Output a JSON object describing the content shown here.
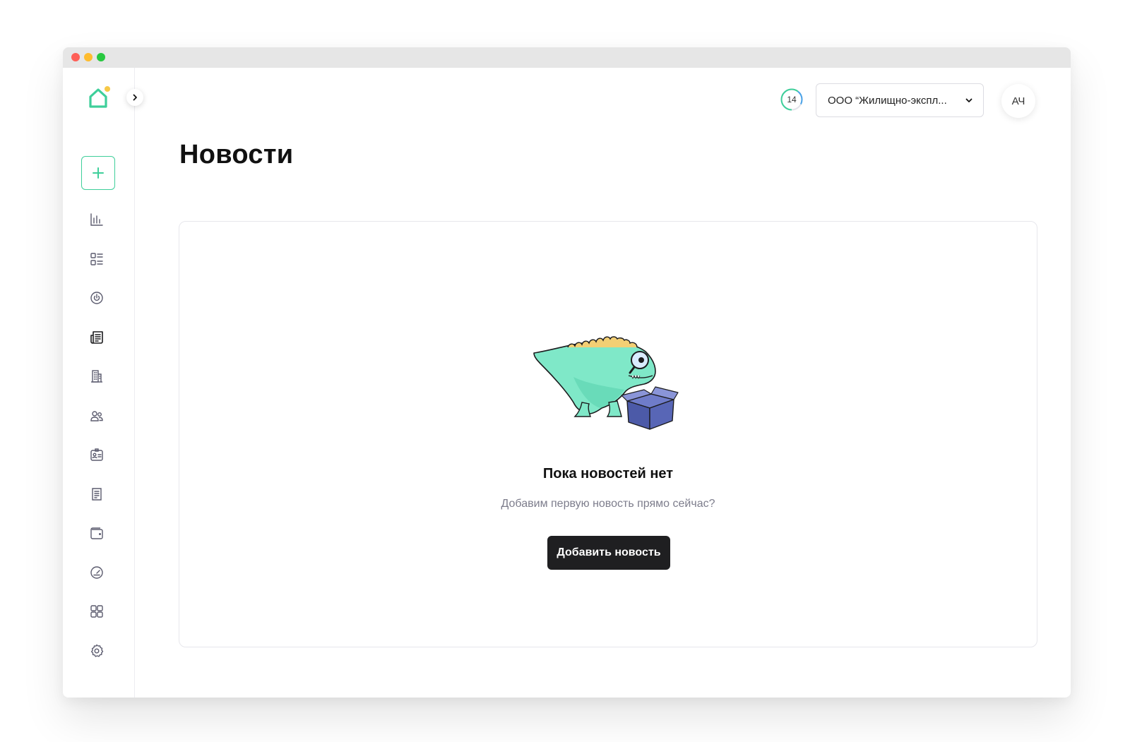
{
  "window": {
    "controls": [
      "close",
      "minimize",
      "maximize"
    ]
  },
  "sidebar": {
    "logo_icon": "home-icon",
    "accent_color": "#3ecf9a",
    "add_button_icon": "plus-icon",
    "collapse_icon": "chevron-right-icon",
    "items": [
      {
        "icon": "bar-chart-icon",
        "active": false
      },
      {
        "icon": "list-icon",
        "active": false
      },
      {
        "icon": "power-icon",
        "active": false
      },
      {
        "icon": "newspaper-icon",
        "active": true
      },
      {
        "icon": "building-icon",
        "active": false
      },
      {
        "icon": "users-icon",
        "active": false
      },
      {
        "icon": "id-card-icon",
        "active": false
      },
      {
        "icon": "document-icon",
        "active": false
      },
      {
        "icon": "wallet-icon",
        "active": false
      },
      {
        "icon": "gauge-icon",
        "active": false
      },
      {
        "icon": "grid-icon",
        "active": false
      },
      {
        "icon": "gear-icon",
        "active": false
      }
    ]
  },
  "header": {
    "counter": "14",
    "org_select": {
      "value": "ООО “Жилищно-экспл...",
      "icon": "chevron-down-icon"
    },
    "avatar_initials": "АЧ"
  },
  "main": {
    "title": "Новости",
    "empty_state": {
      "illustration": "dinosaur-with-magnifier-and-box",
      "title": "Пока новостей нет",
      "subtitle": "Добавим первую новость прямо сейчас?",
      "button_label": "Добавить новость"
    }
  }
}
